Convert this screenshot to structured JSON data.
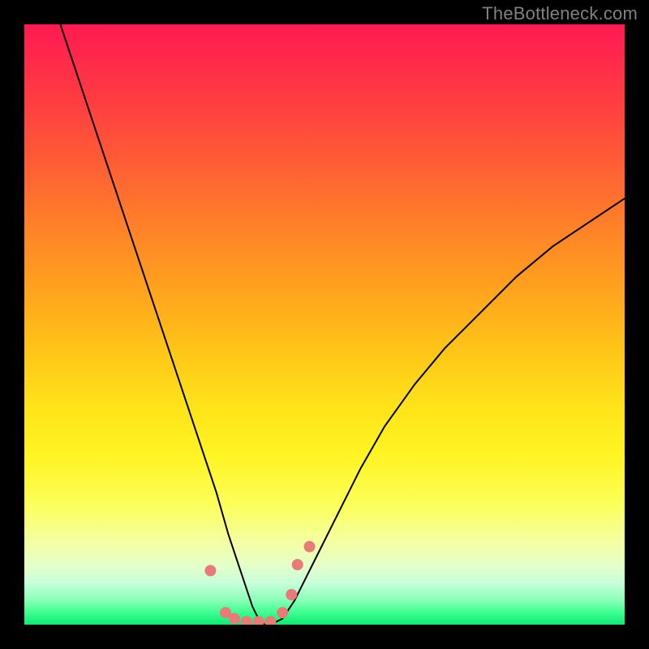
{
  "watermark": {
    "text": "TheBottleneck.com"
  },
  "chart_data": {
    "type": "line",
    "title": "",
    "xlabel": "",
    "ylabel": "",
    "xlim": [
      0,
      100
    ],
    "ylim": [
      0,
      100
    ],
    "grid": false,
    "legend": false,
    "series": [
      {
        "name": "bottleneck-curve",
        "color": "#000000",
        "x": [
          6,
          9,
          12,
          15,
          18,
          21,
          24,
          27,
          30,
          32,
          34,
          36,
          37,
          38,
          39,
          40,
          41,
          43,
          45,
          48,
          52,
          56,
          60,
          65,
          70,
          76,
          82,
          88,
          94,
          100
        ],
        "y": [
          100,
          91,
          82,
          73,
          64,
          55,
          46,
          37,
          28,
          22,
          15,
          9,
          6,
          3,
          1,
          0,
          0,
          1,
          4,
          10,
          18,
          26,
          33,
          40,
          46,
          52,
          58,
          63,
          67,
          71
        ]
      }
    ],
    "markers": {
      "name": "highlight-points",
      "color": "#e77b78",
      "x": [
        31.0,
        33.5,
        35.0,
        37.0,
        39.0,
        41.0,
        43.0,
        44.5,
        45.5,
        47.5
      ],
      "y": [
        9.0,
        2.0,
        1.0,
        0.5,
        0.5,
        0.5,
        2.0,
        5.0,
        10.0,
        13.0
      ]
    },
    "gradient_note": "vertical red→orange→yellow→green background maps to bottleneck severity (red=high, green=low)"
  }
}
